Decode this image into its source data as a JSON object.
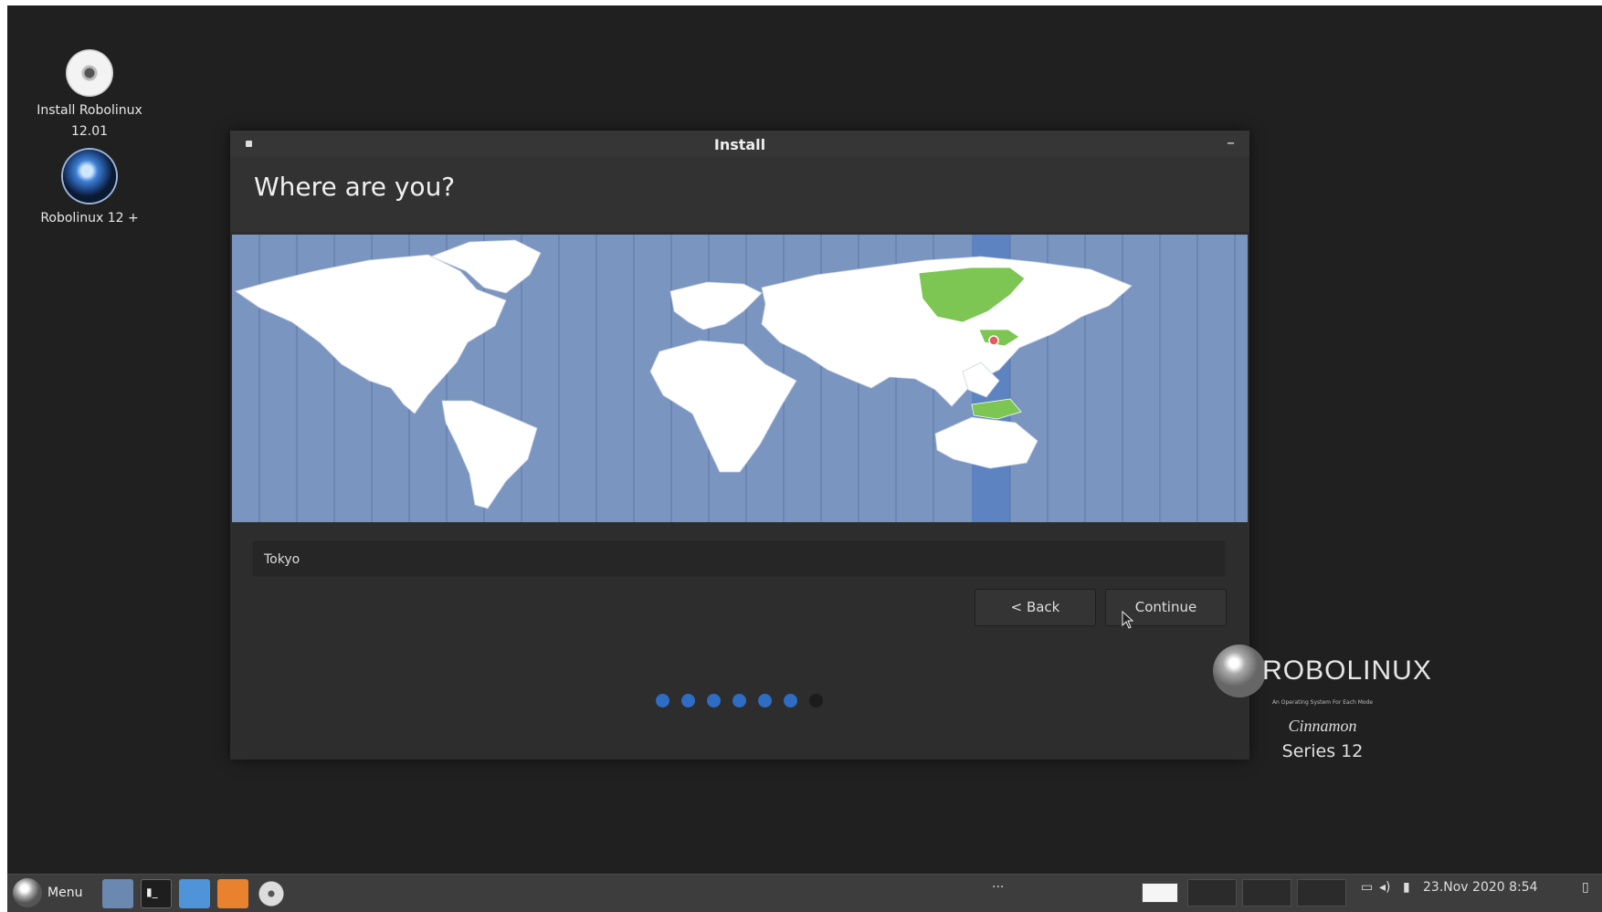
{
  "desktop": {
    "icons": [
      {
        "label_line1": "Install Robolinux",
        "label_line2": "12.01",
        "icon": "disc-icon"
      },
      {
        "label_line1": "Robolinux 12 +",
        "icon": "robolinux-icon"
      }
    ]
  },
  "window": {
    "title": "Install",
    "minimize_glyph": "–",
    "heading": "Where are you?",
    "timezone_value": "Tokyo",
    "back_label": "< Back",
    "continue_label": "Continue",
    "progress": {
      "total_steps": 7,
      "current_step": 6
    },
    "highlight_color": "#7dc653",
    "tz_band_color": "#5d83c1",
    "accent": "#2f6cc4"
  },
  "branding": {
    "logo_text": "ROBOLINUX",
    "tagline": "An Operating System For Each Mode",
    "edition": "Cinnamon",
    "series": "Series 12"
  },
  "taskbar": {
    "menu_label": "Menu",
    "overflow": "···",
    "date": "23.Nov 2020",
    "time": "8:54",
    "tray_icons": [
      "display-icon",
      "volume-icon",
      "battery-icon",
      "notifications-icon"
    ]
  }
}
